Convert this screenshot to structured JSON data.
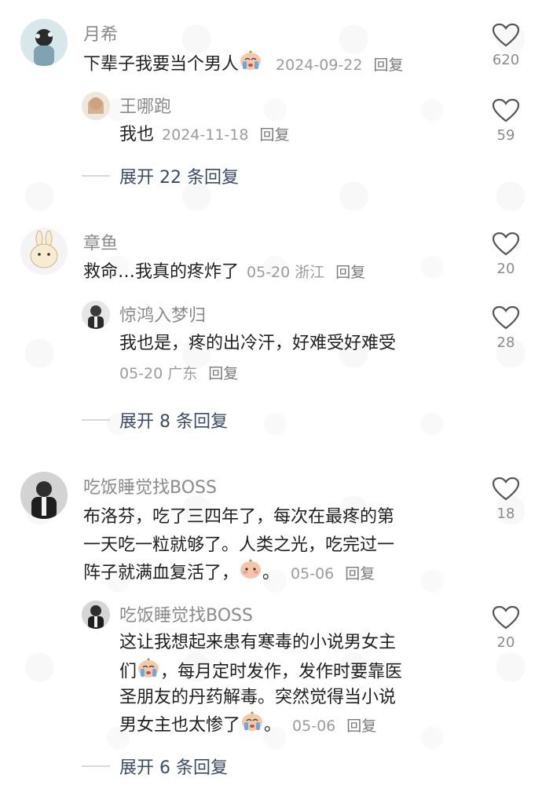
{
  "comments": [
    {
      "username": "月希",
      "text": "下辈子我要当个男人",
      "date": "2024-09-22",
      "reply": "回复",
      "likes": "620",
      "sub": {
        "username": "王哪跑",
        "text": "我也",
        "date": "2024-11-18",
        "reply": "回复",
        "likes": "59"
      },
      "expand": "展开 22 条回复"
    },
    {
      "username": "章鱼",
      "text": "救命…我真的疼炸了",
      "date": "05-20",
      "location": "浙江",
      "reply": "回复",
      "likes": "20",
      "sub": {
        "username": "惊鸿入梦归",
        "text": "我也是，疼的出冷汗，好难受好难受",
        "date": "05-20",
        "location": "广东",
        "reply": "回复",
        "likes": "28"
      },
      "expand": "展开 8 条回复"
    },
    {
      "username": "吃饭睡觉找BOSS",
      "text_line1": "布洛芬，吃了三四年了，每次在最疼的第",
      "text_line2": "一天吃一粒就够了。人类之光，吃完过一",
      "text_line3": "阵子就满血复活了，",
      "text_tail": "。",
      "date": "05-06",
      "reply": "回复",
      "likes": "18",
      "sub": {
        "username": "吃饭睡觉找BOSS",
        "line1": "这让我想起来患有寒毒的小说男女主",
        "line2_a": "们",
        "line2_b": "，每月定时发作，发作时要靠医",
        "line3": "圣朋友的丹药解毒。突然觉得当小说",
        "line4": "男女主也太惨了",
        "line4_tail": "。",
        "date": "05-06",
        "reply": "回复",
        "likes": "20"
      },
      "expand": "展开 6 条回复"
    }
  ]
}
